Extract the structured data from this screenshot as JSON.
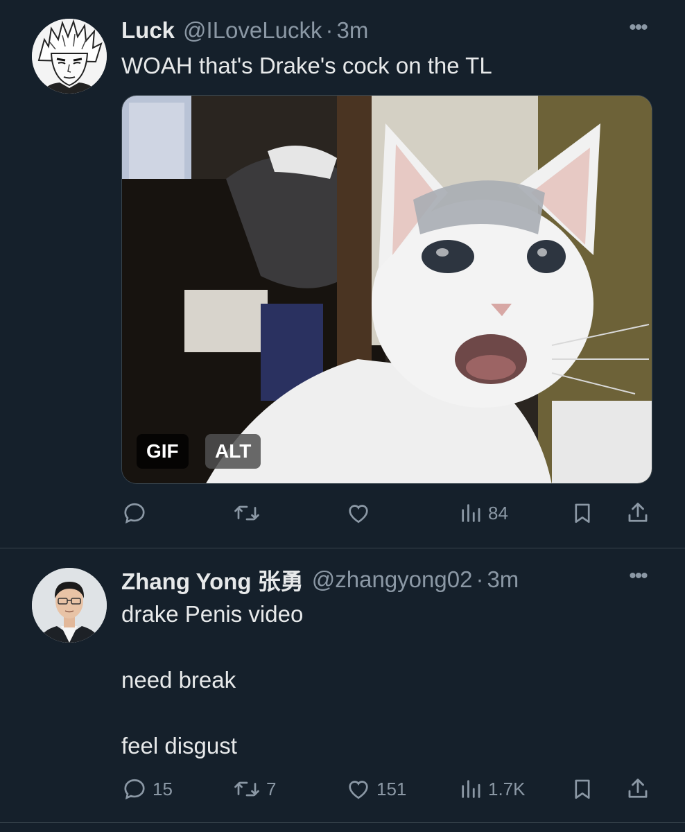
{
  "tweets": [
    {
      "display_name": "Luck",
      "handle": "@ILoveLuckk",
      "separator": "·",
      "time": "3m",
      "text": "WOAH that's Drake's cock on the TL",
      "media": {
        "badges": [
          "GIF",
          "ALT"
        ]
      },
      "actions": {
        "reply": "",
        "retweet": "",
        "like": "",
        "views": "84"
      }
    },
    {
      "display_name": "Zhang Yong 张勇",
      "handle": "@zhangyong02",
      "separator": "·",
      "time": "3m",
      "text_lines": [
        "drake Penis video",
        "need break",
        "feel disgust"
      ],
      "actions": {
        "reply": "15",
        "retweet": "7",
        "like": "151",
        "views": "1.7K"
      }
    }
  ],
  "more_glyph": "•••",
  "colors": {
    "background": "#15202b",
    "text_primary": "#e7e9ea",
    "text_secondary": "#8b98a5",
    "divider": "#38444d"
  },
  "icons": [
    "reply-icon",
    "retweet-icon",
    "like-icon",
    "views-icon",
    "bookmark-icon",
    "share-icon",
    "more-icon"
  ]
}
